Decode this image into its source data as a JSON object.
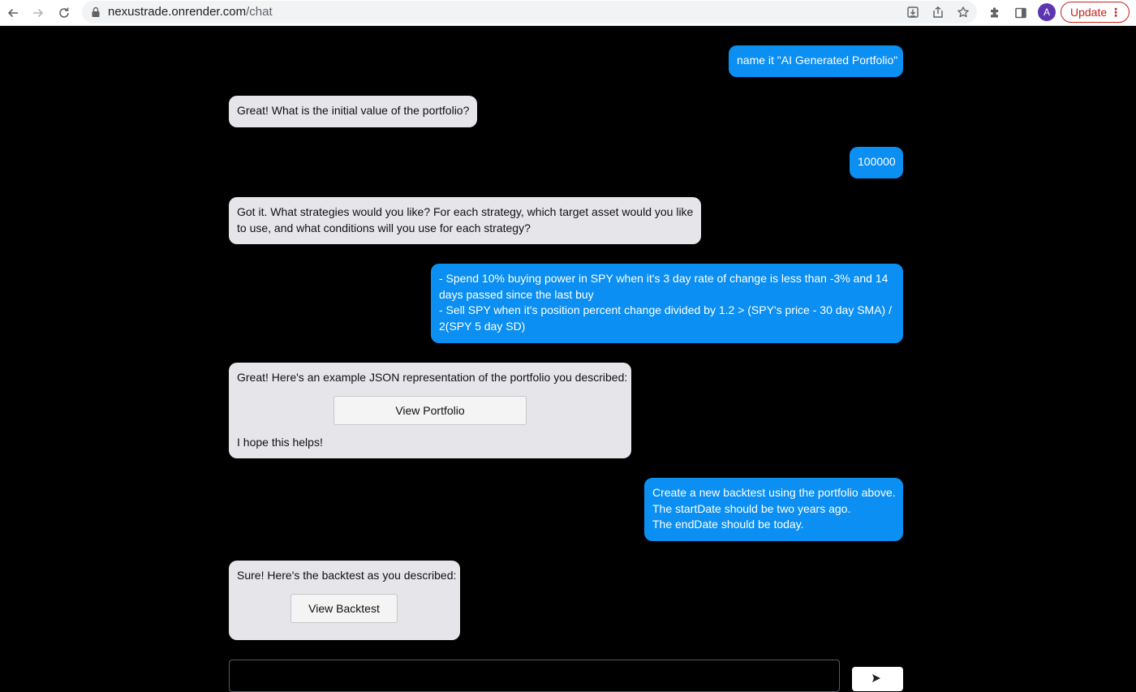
{
  "browser": {
    "url_host": "nexustrade.onrender.com",
    "url_path": "/chat",
    "profile_initial": "A",
    "update_label": "Update",
    "update_menu_glyph": "⋮"
  },
  "messages": [
    {
      "role": "user",
      "lines": [
        "name it \"AI Generated Portfolio\""
      ]
    },
    {
      "role": "bot",
      "lines": [
        "Great! What is the initial value of the portfolio?"
      ]
    },
    {
      "role": "user",
      "lines": [
        "100000"
      ]
    },
    {
      "role": "bot",
      "lines": [
        "Got it. What strategies would you like? For each strategy, which target asset would you like",
        "to use, and what conditions will you use for each strategy?"
      ]
    },
    {
      "role": "user",
      "lines": [
        "- Spend 10% buying power in SPY when it's 3 day rate of change is less than -3% and 14",
        "days passed since the last buy",
        "- Sell SPY when it's position percent change divided by 1.2 > (SPY's price - 30 day SMA) /",
        "2(SPY 5 day SD)"
      ]
    },
    {
      "role": "bot",
      "lines": [
        "Great! Here's an example JSON representation of the portfolio you described:"
      ],
      "button_label": "View Portfolio",
      "footer": "I hope this helps!"
    },
    {
      "role": "user",
      "lines": [
        "Create a new backtest using the portfolio above.",
        "The startDate should be two years ago.",
        "The endDate should be today."
      ]
    },
    {
      "role": "bot",
      "lines": [
        "Sure! Here's the backtest as you described:"
      ],
      "button_label": "View Backtest"
    }
  ],
  "colors": {
    "user_bubble": "#0b8ff2",
    "bot_bubble": "#e6e6ea",
    "background": "#000000",
    "update_red": "#c5221f"
  },
  "icons": [
    "back-arrow-icon",
    "forward-arrow-icon",
    "reload-icon",
    "lock-icon",
    "install-app-icon",
    "share-icon",
    "bookmark-star-icon",
    "extensions-puzzle-icon",
    "side-panel-icon",
    "send-arrow-icon"
  ]
}
